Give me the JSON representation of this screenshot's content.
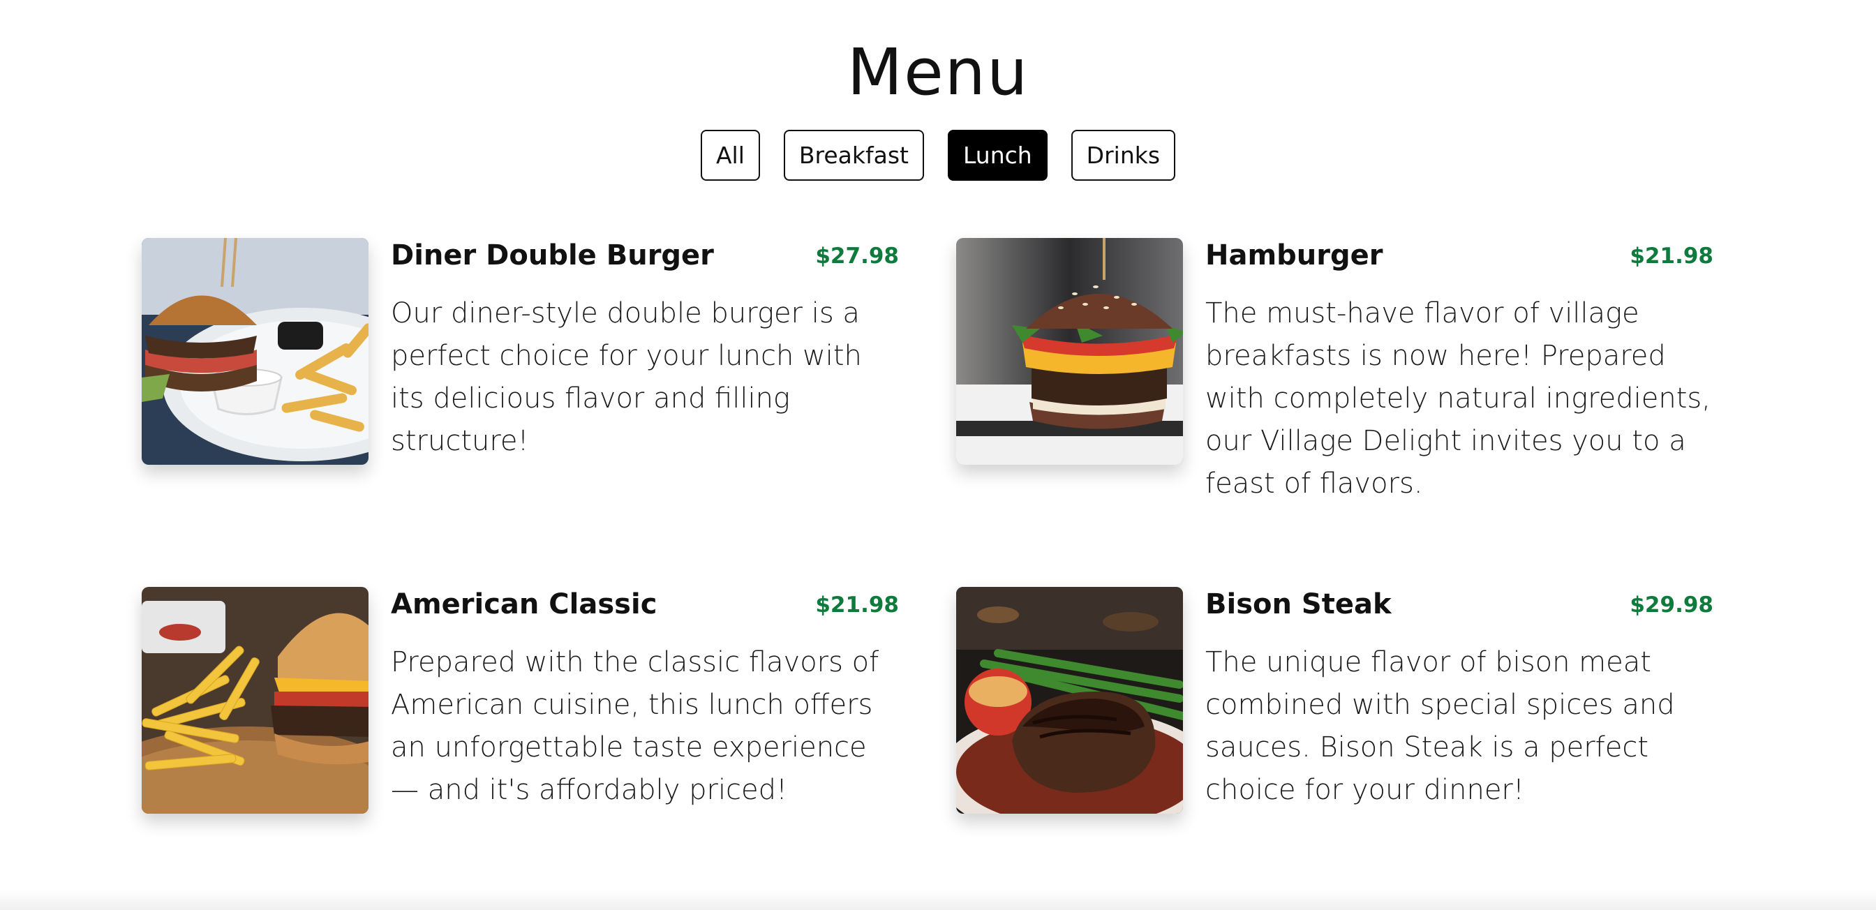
{
  "page": {
    "title": "Menu"
  },
  "filters": [
    {
      "label": "All",
      "active": false
    },
    {
      "label": "Breakfast",
      "active": false
    },
    {
      "label": "Lunch",
      "active": true
    },
    {
      "label": "Drinks",
      "active": false
    }
  ],
  "theme": {
    "price_color": "#0e7a3b",
    "active_filter_bg": "#000000",
    "active_filter_text": "#ffffff"
  },
  "items": [
    {
      "name": "Diner Double Burger",
      "price": "$27.98",
      "description": "Our diner-style double burger is a perfect choice for your lunch with its delicious flavor and filling structure!",
      "image": "burger-fries-plate-photo"
    },
    {
      "name": "Hamburger",
      "price": "$21.98",
      "description": "The must-have flavor of village breakfasts is now here! Prepared with completely natural ingredients, our Village Delight invites you to a feast of flavors.",
      "image": "egg-burger-photo"
    },
    {
      "name": "American Classic",
      "price": "$21.98",
      "description": "Prepared with the classic flavors of American cuisine, this lunch offers an unforgettable taste experience — and it's affordably priced!",
      "image": "cheeseburger-fries-board-photo"
    },
    {
      "name": "Bison Steak",
      "price": "$29.98",
      "description": "The unique flavor of bison meat combined with special spices and sauces. Bison Steak is a perfect choice for your dinner!",
      "image": "steak-asparagus-photo"
    }
  ]
}
